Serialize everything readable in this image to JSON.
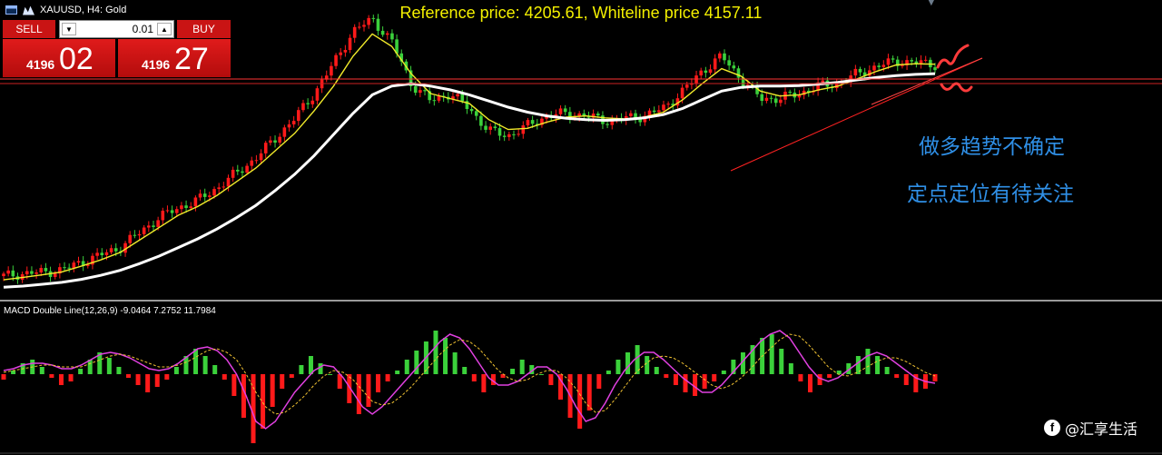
{
  "header": {
    "symbol_label": "XAUUSD, H4:  Gold",
    "reference_text": "Reference price: 4205.61, Whiteline price 4157.11"
  },
  "trade_panel": {
    "sell_label": "SELL",
    "buy_label": "BUY",
    "lot_value": "0.01",
    "sell_price_small": "4196",
    "sell_price_big": "02",
    "buy_price_small": "4196",
    "buy_price_big": "27"
  },
  "annotations": {
    "line1": "做多趋势不确定",
    "line2": "定点定位有待关注"
  },
  "macd_label": "MACD Double Line(12,26,9) -9.0464 7.2752 11.7984",
  "watermark": "@汇享生活",
  "colors": {
    "up_candle": "#ff1a1a",
    "down_candle": "#3bd13b",
    "yellow_ma": "#f1ea2a",
    "white_ma": "#ffffff",
    "macd_line": "#e040e0",
    "signal_line": "#f1c232",
    "annotation_blue": "#2f8fe6"
  },
  "chart_data": [
    {
      "type": "line",
      "title": "Reference price: 4205.61, Whiteline price 4157.11",
      "series": [
        {
          "name": "Price",
          "values": [
            3345,
            3355,
            3360,
            3370,
            3400,
            3430,
            3460,
            3520,
            3580,
            3620,
            3650,
            3700,
            3760,
            3820,
            3900,
            3980,
            4080,
            4200,
            4330,
            4380,
            4290,
            4120,
            4050,
            4080,
            4020,
            3930,
            3910,
            3950,
            3990,
            4000,
            3990,
            3970,
            3980,
            3990,
            4020,
            4090,
            4170,
            4230,
            4140,
            4060,
            4060,
            4080,
            4110,
            4120,
            4160,
            4190,
            4210,
            4205,
            4196
          ]
        },
        {
          "values": [
            3330,
            3340,
            3350,
            3362,
            3385,
            3410,
            3440,
            3490,
            3540,
            3590,
            3625,
            3670,
            3725,
            3780,
            3850,
            3920,
            4010,
            4110,
            4230,
            4320,
            4270,
            4160,
            4080,
            4060,
            4040,
            3975,
            3935,
            3940,
            3965,
            3985,
            3990,
            3982,
            3978,
            3985,
            4005,
            4055,
            4120,
            4180,
            4150,
            4090,
            4070,
            4075,
            4095,
            4110,
            4140,
            4170,
            4195,
            4200,
            4198
          ]
        },
        {
          "values": [
            3300,
            3305,
            3312,
            3320,
            3332,
            3348,
            3368,
            3395,
            3425,
            3460,
            3495,
            3535,
            3580,
            3630,
            3690,
            3755,
            3830,
            3915,
            4000,
            4075,
            4110,
            4120,
            4110,
            4095,
            4075,
            4050,
            4025,
            4005,
            3990,
            3980,
            3975,
            3972,
            3975,
            3982,
            3995,
            4020,
            4055,
            4090,
            4105,
            4110,
            4110,
            4112,
            4118,
            4125,
            4135,
            4145,
            4152,
            4157,
            4160
          ]
        }
      ]
    },
    {
      "type": "bar",
      "title": "MACD Double Line(12,26,9) -9.0464 7.2752 11.7984",
      "series": [
        {
          "name": "Histogram",
          "values": [
            -3,
            2,
            6,
            8,
            4,
            -2,
            -6,
            -4,
            3,
            8,
            12,
            9,
            4,
            -2,
            -6,
            -10,
            -7,
            -3,
            4,
            10,
            14,
            10,
            5,
            -3,
            -12,
            -24,
            -38,
            -30,
            -18,
            -8,
            -2,
            5,
            10,
            6,
            0,
            -8,
            -16,
            -22,
            -18,
            -10,
            -4,
            2,
            8,
            13,
            18,
            24,
            20,
            12,
            4,
            -4,
            -10,
            -6,
            -2,
            3,
            8,
            5,
            0,
            -6,
            -14,
            -24,
            -30,
            -20,
            -8,
            2,
            8,
            12,
            16,
            10,
            4,
            -2,
            -6,
            -10,
            -12,
            -8,
            -4,
            2,
            8,
            12,
            16,
            20,
            22,
            14,
            6,
            -4,
            -10,
            -6,
            -2,
            2,
            6,
            10,
            14,
            10,
            4,
            -2,
            -6,
            -10,
            -8,
            -4
          ]
        },
        {
          "name": "MACD",
          "values": [
            2,
            3,
            5,
            6,
            6,
            5,
            3,
            3,
            5,
            8,
            11,
            12,
            11,
            9,
            6,
            3,
            2,
            3,
            6,
            10,
            14,
            15,
            13,
            8,
            0,
            -12,
            -26,
            -30,
            -26,
            -18,
            -10,
            -4,
            2,
            5,
            4,
            -2,
            -10,
            -18,
            -22,
            -18,
            -12,
            -6,
            0,
            6,
            12,
            18,
            22,
            20,
            14,
            6,
            -2,
            -6,
            -6,
            -4,
            0,
            4,
            4,
            0,
            -8,
            -18,
            -26,
            -24,
            -16,
            -6,
            2,
            8,
            12,
            12,
            8,
            3,
            -2,
            -6,
            -10,
            -10,
            -6,
            0,
            6,
            12,
            18,
            22,
            24,
            20,
            12,
            4,
            -2,
            -4,
            -2,
            2,
            6,
            10,
            12,
            10,
            6,
            2,
            -2,
            -4,
            -5
          ]
        },
        {
          "name": "Signal",
          "values": [
            1,
            2,
            3,
            4,
            5,
            5,
            4,
            4,
            4,
            6,
            8,
            10,
            11,
            10,
            8,
            6,
            4,
            4,
            5,
            7,
            10,
            13,
            14,
            12,
            8,
            0,
            -10,
            -18,
            -22,
            -21,
            -17,
            -12,
            -6,
            -1,
            2,
            1,
            -3,
            -9,
            -15,
            -17,
            -16,
            -12,
            -7,
            -1,
            5,
            11,
            16,
            19,
            18,
            14,
            8,
            2,
            -2,
            -4,
            -3,
            0,
            2,
            2,
            -2,
            -8,
            -16,
            -21,
            -20,
            -14,
            -7,
            0,
            5,
            9,
            10,
            9,
            6,
            2,
            -2,
            -6,
            -8,
            -6,
            -2,
            3,
            9,
            14,
            19,
            22,
            21,
            16,
            10,
            4,
            0,
            -1,
            1,
            4,
            7,
            9,
            9,
            7,
            4,
            1,
            -1
          ]
        }
      ]
    }
  ]
}
